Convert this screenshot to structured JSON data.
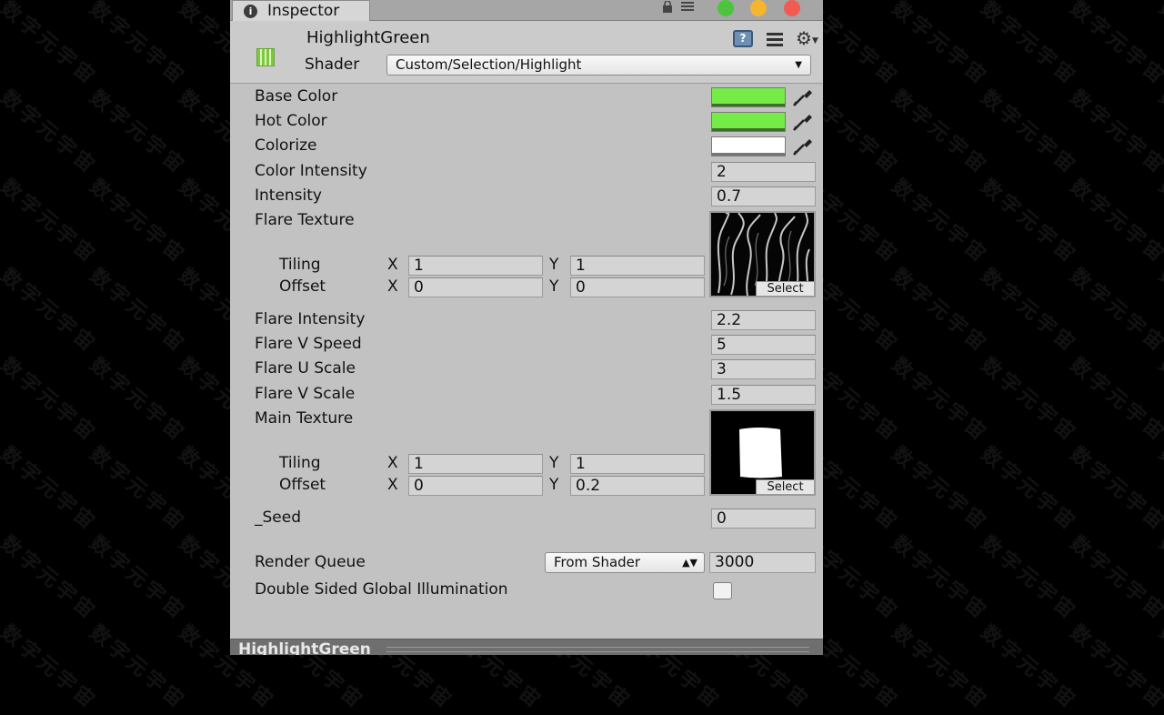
{
  "window": {
    "tab_title": "Inspector",
    "tab_icon": "info-icon",
    "traffic_lights": [
      "#4cc43f",
      "#f5b52e",
      "#f25b52"
    ]
  },
  "material": {
    "name": "HighlightGreen",
    "shader_label": "Shader",
    "shader_value": "Custom/Selection/Highlight"
  },
  "props": {
    "base_color": {
      "label": "Base Color",
      "color": "#74eb47"
    },
    "hot_color": {
      "label": "Hot Color",
      "color": "#74eb47"
    },
    "colorize": {
      "label": "Colorize",
      "color": "#ffffff"
    },
    "color_intensity": {
      "label": "Color Intensity",
      "value": "2"
    },
    "intensity": {
      "label": "Intensity",
      "value": "0.7"
    },
    "flare_texture": {
      "label": "Flare Texture",
      "tiling_label": "Tiling",
      "offset_label": "Offset",
      "x_label": "X",
      "y_label": "Y",
      "tiling_x": "1",
      "tiling_y": "1",
      "offset_x": "0",
      "offset_y": "0",
      "select_label": "Select"
    },
    "flare_intensity": {
      "label": "Flare Intensity",
      "value": "2.2"
    },
    "flare_v_speed": {
      "label": "Flare V Speed",
      "value": "5"
    },
    "flare_u_scale": {
      "label": "Flare U Scale",
      "value": "3"
    },
    "flare_v_scale": {
      "label": "Flare V Scale",
      "value": "1.5"
    },
    "main_texture": {
      "label": "Main Texture",
      "tiling_label": "Tiling",
      "offset_label": "Offset",
      "x_label": "X",
      "y_label": "Y",
      "tiling_x": "1",
      "tiling_y": "1",
      "offset_x": "0",
      "offset_y": "0.2",
      "select_label": "Select"
    },
    "seed": {
      "label": "_Seed",
      "value": "0"
    }
  },
  "render_queue": {
    "label": "Render Queue",
    "mode": "From Shader",
    "value": "3000"
  },
  "double_sided_gi": {
    "label": "Double Sided Global Illumination",
    "checked": false
  },
  "preview": {
    "title": "HighlightGreen"
  },
  "watermark": "数字元宇宙"
}
